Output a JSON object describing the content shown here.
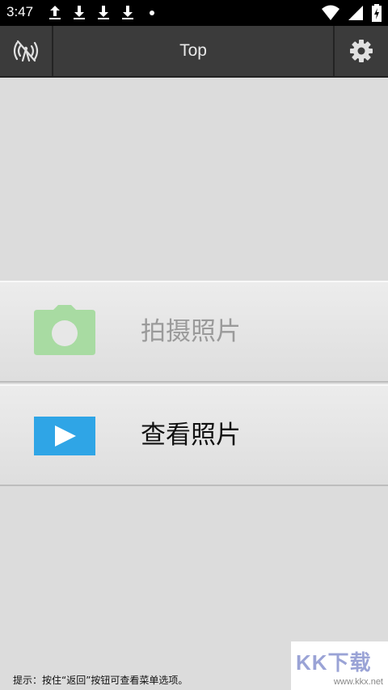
{
  "status_bar": {
    "time": "3:47",
    "notification_icons": [
      "upload-icon",
      "download-icon",
      "download-icon",
      "download-icon",
      "dot-icon"
    ],
    "right_icons": [
      "wifi-icon",
      "signal-icon",
      "battery-icon"
    ]
  },
  "toolbar": {
    "title": "Top",
    "left_icon": "wireless-off-icon",
    "right_icon": "gear-icon"
  },
  "menu": {
    "items": [
      {
        "label": "拍摄照片",
        "icon": "camera-icon",
        "enabled": false,
        "icon_color": "#a8dba2"
      },
      {
        "label": "查看照片",
        "icon": "play-icon",
        "enabled": true,
        "icon_color": "#2fa5e6"
      }
    ]
  },
  "hint": "提示：按住“返回”按钮可查看菜单选项。",
  "watermark": {
    "text": "KK下载",
    "url": "www.kkx.net"
  },
  "colors": {
    "background": "#dcdcdc",
    "toolbar": "#3b3b3b",
    "status_bar": "#000000"
  }
}
